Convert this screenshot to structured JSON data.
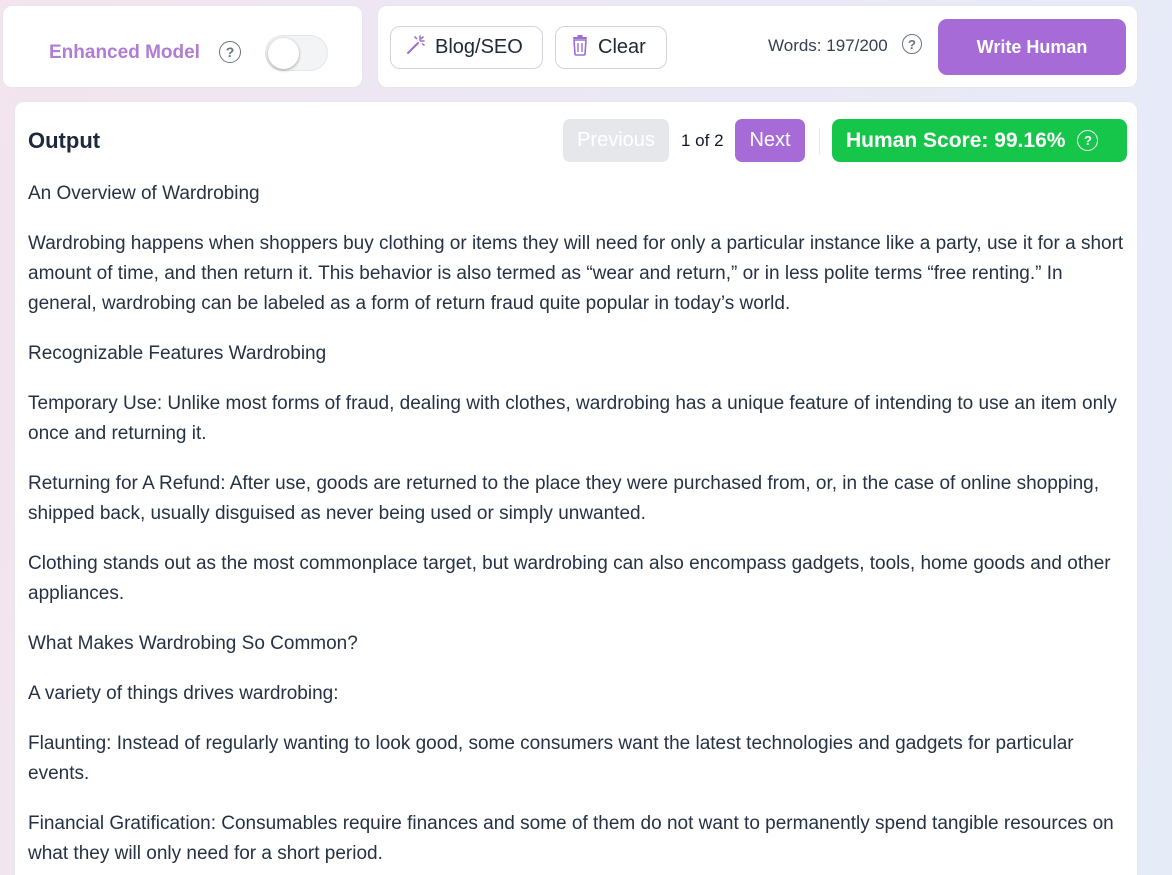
{
  "model": {
    "label": "Enhanced Model",
    "help_glyph": "?",
    "toggle_on": false
  },
  "toolbar": {
    "blog_label": "Blog/SEO",
    "clear_label": "Clear",
    "words_label": "Words: 197/200",
    "help_glyph": "?",
    "write_label": "Write Human"
  },
  "output": {
    "title": "Output",
    "previous_label": "Previous",
    "pager_text": "1 of 2",
    "next_label": "Next",
    "score_text": "Human Score: 99.16%",
    "help_glyph": "?",
    "paragraphs": [
      "An Overview of Wardrobing",
      "Wardrobing happens when shoppers buy clothing or items they will need for only a particular instance like a party, use it for a short amount of time, and then return it. This behavior is also termed as “wear and return,” or in less polite terms “free renting.” In general, wardrobing can be labeled as a form of return fraud quite popular in today’s world.",
      "Recognizable Features Wardrobing",
      "Temporary Use: Unlike most forms of fraud, dealing with clothes, wardrobing has a unique feature of intending to use an item only once and returning it.",
      "Returning for A Refund: After use, goods are returned to the place they were purchased from, or, in the case of online shopping, shipped back, usually disguised as never being used or simply unwanted.",
      "Clothing stands out as the most commonplace target, but wardrobing can also encompass gadgets, tools, home goods and other appliances.",
      "What Makes Wardrobing So Common?",
      "A variety of things drives wardrobing:",
      "Flaunting: Instead of regularly wanting to look good, some consumers want the latest technologies and gadgets for particular events.",
      "Financial Gratification: Consumables require finances and some of them do not want to permanently spend tangible resources on what they will only need for a short period."
    ]
  },
  "colors": {
    "accent": "#a66bd6",
    "score": "#16c64a",
    "model_label": "#b07cd4"
  },
  "icons": [
    "help-icon",
    "magic-wand-icon",
    "trash-icon"
  ]
}
